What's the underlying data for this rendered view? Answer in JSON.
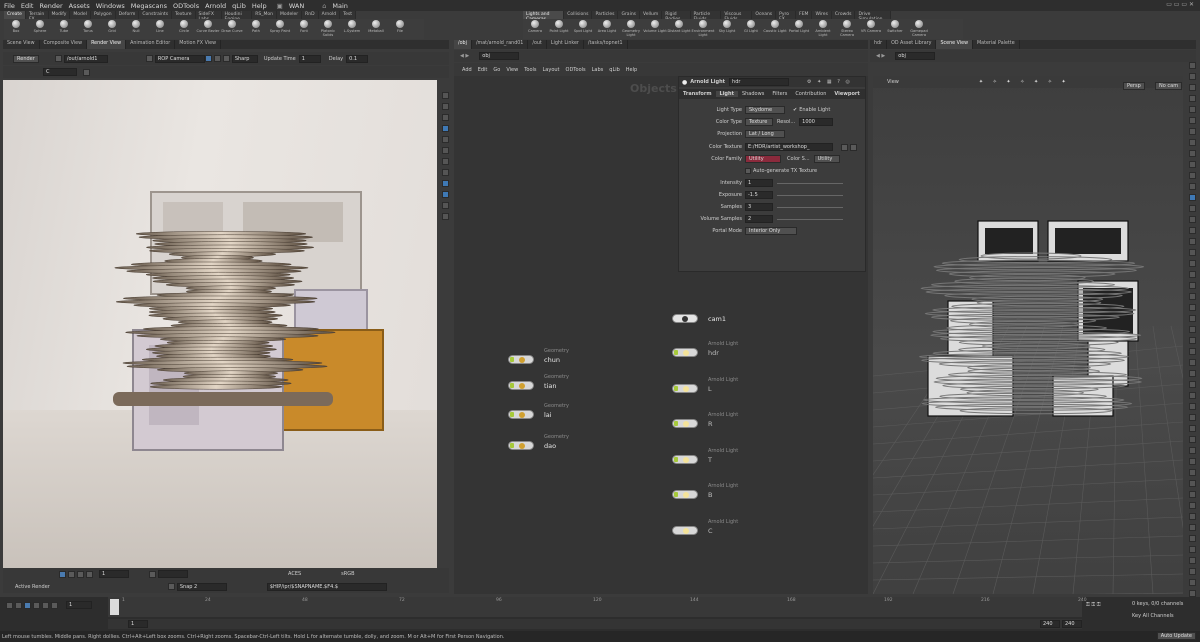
{
  "menu": [
    "File",
    "Edit",
    "Render",
    "Assets",
    "Windows",
    "Megascans",
    "ODTools",
    "Arnold",
    "qLib",
    "Help"
  ],
  "desktop": "WAN",
  "takes": "Main",
  "left_shelf_tabs": [
    "Create",
    "Terrain FX",
    "Modify",
    "Model",
    "Polygon",
    "Deform",
    "Constraints",
    "Texture",
    "SideFX Labs",
    "Houdini Engine",
    "RS_Mon",
    "Modeler",
    "RnD",
    "Arnold",
    "Test"
  ],
  "left_shelf_tools": [
    "Box",
    "Sphere",
    "Tube",
    "Torus",
    "Grid",
    "Null",
    "Line",
    "Circle",
    "Curve Bezier",
    "Draw Curve",
    "Path",
    "Spray Paint",
    "Font",
    "Platonic Solids",
    "L-System",
    "Metaball",
    "File"
  ],
  "right_shelf_tabs": [
    "Lights and Cameras",
    "Collisions",
    "Particles",
    "Grains",
    "Vellum",
    "Rigid Bodies",
    "Particle Fluids",
    "Viscous Fluids",
    "Oceans",
    "Pyro FX",
    "FEM",
    "Wires",
    "Crowds",
    "Drive Simulation"
  ],
  "right_shelf_tools": [
    "Camera",
    "Point Light",
    "Spot Light",
    "Area Light",
    "Geometry Light",
    "Volume Light",
    "Distant Light",
    "Environment Light",
    "Sky Light",
    "GI Light",
    "Caustic Light",
    "Portal Light",
    "Ambient Light",
    "Stereo Camera",
    "VR Camera",
    "Switcher",
    "Gamepad Camera"
  ],
  "left_pane_tabs": [
    "Scene View",
    "Composite View",
    "Render View",
    "Animation Editor",
    "Motion FX View"
  ],
  "render_toolbar": {
    "render_label": "Render",
    "rop_path": "/out/arnold1",
    "rop_camera": "ROP Camera",
    "sharp": "Sharp",
    "update_time_label": "Update Time",
    "update_time": "1",
    "delay_label": "Delay",
    "delay": "0.1",
    "channel": "C"
  },
  "render_bottom": {
    "frame": "1",
    "active_render": "Active Render",
    "snap": "Snap 2",
    "aces": "ACES",
    "srgb": "sRGB",
    "snapname": "$HIP/ipr/$SNAPNAME.$F4.$"
  },
  "mid_pane_tabs": [
    "/obj",
    "/mat/arnold_rand01",
    "/out",
    "Light Linker",
    "/tasks/topnet1"
  ],
  "net_path": "obj",
  "net_menu": [
    "Add",
    "Edit",
    "Go",
    "View",
    "Tools",
    "Layout",
    "ODTools",
    "Labs",
    "qLib",
    "Help"
  ],
  "net_watermark": "Objects",
  "param": {
    "title": "Arnold Light",
    "name": "hdr",
    "tabs": [
      "Transform",
      "Light",
      "Shadows",
      "Filters",
      "Contribution",
      "Viewport"
    ],
    "light_type_label": "Light Type",
    "light_type": "Skydome",
    "enable_light": "Enable Light",
    "color_type_label": "Color Type",
    "color_type": "Texture",
    "resol_label": "Resol...",
    "resol": "1000",
    "projection_label": "Projection",
    "projection": "Lat / Long",
    "color_texture_label": "Color Texture",
    "color_texture": "E:/HDR/artist_workshop_",
    "color_family_label": "Color Family",
    "color_family": "Utility",
    "color_s_label": "Color S...",
    "color_s": "Utility",
    "auto_tx": "Auto-generate TX Texture",
    "intensity_label": "Intensity",
    "intensity": "1",
    "exposure_label": "Exposure",
    "exposure": "-1.5",
    "samples_label": "Samples",
    "samples": "3",
    "volume_samples_label": "Volume Samples",
    "volume_samples": "2",
    "portal_mode_label": "Portal Mode",
    "portal_mode": "Interior Only"
  },
  "geo_nodes": [
    {
      "type": "Geometry",
      "name": "chun"
    },
    {
      "type": "Geometry",
      "name": "tian"
    },
    {
      "type": "Geometry",
      "name": "lai"
    },
    {
      "type": "Geometry",
      "name": "dao"
    }
  ],
  "cam_node": {
    "name": "cam1"
  },
  "light_nodes": [
    {
      "type": "Arnold Light",
      "name": "hdr"
    },
    {
      "type": "Arnold Light",
      "name": "L"
    },
    {
      "type": "Arnold Light",
      "name": "R"
    },
    {
      "type": "Arnold Light",
      "name": "T"
    },
    {
      "type": "Arnold Light",
      "name": "B"
    },
    {
      "type": "Arnold Light",
      "name": "C"
    }
  ],
  "right_pane_tabs": [
    "hdr",
    "OD Asset Library",
    "Scene View",
    "Material Palette"
  ],
  "viewport": {
    "path": "obj",
    "label": "View",
    "persp": "Persp",
    "cam": "No cam"
  },
  "timeline": {
    "ticks": [
      "1",
      "24",
      "48",
      "72",
      "96",
      "120",
      "144",
      "168",
      "192",
      "216",
      "240"
    ],
    "frame": "1",
    "start": "1",
    "end_a": "240",
    "end_b": "240",
    "keys": "0 keys, 0/0 channels",
    "key_all": "Key All Channels",
    "auto_update": "Auto Update"
  },
  "status_text": "Left mouse tumbles. Middle pans. Right dollies. Ctrl+Alt+Left box zooms. Ctrl+Right zooms. Spacebar-Ctrl-Left tilts. Hold L for alternate tumble, dolly, and zoom.   M or Alt+M for First Person Navigation.",
  "colors": {
    "accent": "#4a7bb0",
    "node_flag": "#a6c93a",
    "utility_red": "#8b2a3c",
    "orange_panel": "#c98a2a"
  }
}
